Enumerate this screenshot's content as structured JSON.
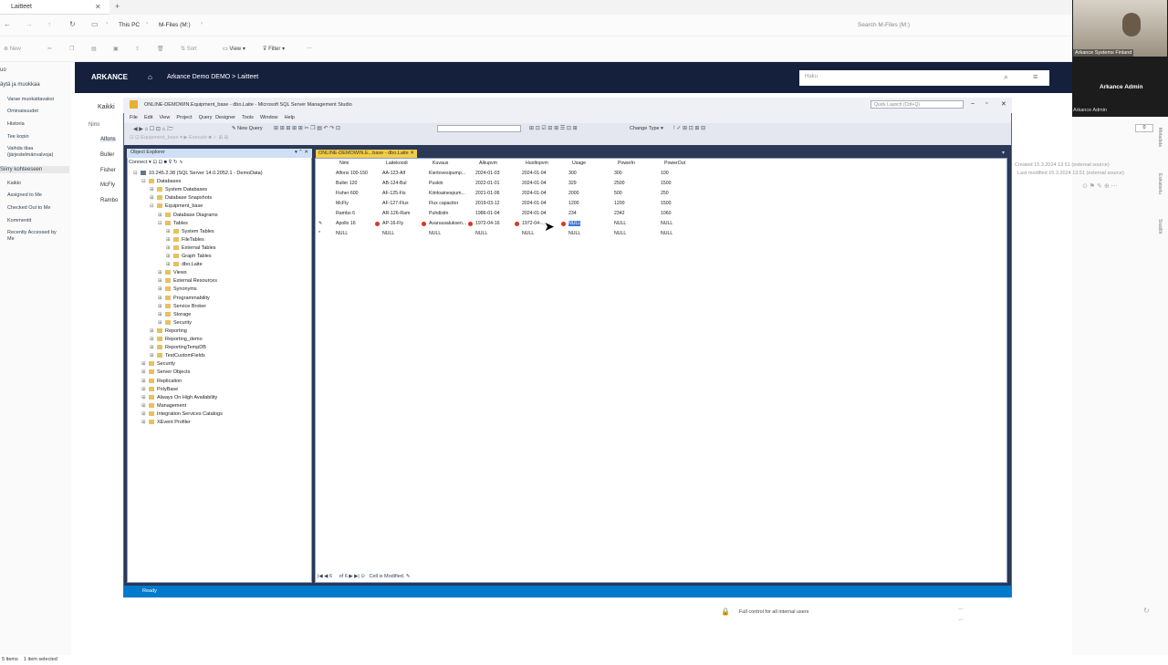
{
  "explorer": {
    "tab_title": "Laitteet",
    "breadcrumb": [
      "This PC",
      "M-Files (M:)"
    ],
    "search_placeholder": "Search M-Files (M:)",
    "cmd": {
      "new": "New",
      "sort": "Sort",
      "view": "View",
      "filter": "Filter",
      "more": "···"
    },
    "left_items": [
      "uo",
      "äytä ja muokkaa",
      "Varae muokattavaksi",
      "Ominaisuudet",
      "Historia",
      "Tee kopio",
      "Vaihda tilaa (järjestelmänvalvoja)",
      "Siirry kohteeseen",
      "Kaikki",
      "Assigned to Me",
      "Checked Out to Me",
      "Kommentit",
      "Recently Accessed by Me"
    ],
    "status": {
      "items": "5 items",
      "selected": "1 item selected"
    }
  },
  "mfiles": {
    "logo": "ARKANCE",
    "crumb": "Arkance Demo DEMO > Laitteet",
    "search_placeholder": "Haku",
    "view_label": "Kaikki",
    "col_name": "Nimi",
    "list": [
      "Alfons",
      "Buller",
      "Fisher",
      "McFly",
      "Rambo"
    ],
    "count": "0",
    "created": "Created 15.3.2024 13.51 (external source)",
    "modified": "Last modified 15.3.2024 13.51 (external source)",
    "permission": "Full control for all internal users",
    "side_tabs": [
      "Metadata",
      "Esikatselu",
      "Sisällöt"
    ]
  },
  "meeting": {
    "org": "Arkance Systems Finland",
    "user": "Arkance Admin",
    "user_small": "Arkance Admin"
  },
  "ssms": {
    "title": "ONLINE-DEMOWIN.Equipment_base - dbo.Laite - Microsoft SQL Server Management Studio",
    "quick_launch": "Quick Launch (Ctrl+Q)",
    "menu": [
      "File",
      "Edit",
      "View",
      "Project",
      "Query Designer",
      "Tools",
      "Window",
      "Help"
    ],
    "new_query": "New Query",
    "change_type": "Change Type",
    "execute": "Execute",
    "db_select": "Equipment_base",
    "oe_title": "Object Explorer",
    "connect": "Connect",
    "tab_label": "ONLINE-DEMOWIN.E...base - dbo.Laite",
    "status": "Ready",
    "nav": {
      "page": "6",
      "of": "of 6",
      "cell_msg": "Cell is Modified."
    }
  },
  "tree": [
    {
      "label": "10.245.2.38 (SQL Server 14.0.2052.1 - DemoData)",
      "lvl": 0,
      "pm": "⊟"
    },
    {
      "label": "Databases",
      "lvl": 1,
      "pm": "⊟"
    },
    {
      "label": "System Databases",
      "lvl": 2,
      "pm": "⊞"
    },
    {
      "label": "Database Snapshots",
      "lvl": 2,
      "pm": "⊞"
    },
    {
      "label": "Equipment_base",
      "lvl": 2,
      "pm": "⊟"
    },
    {
      "label": "Database Diagrams",
      "lvl": 3,
      "pm": "⊞"
    },
    {
      "label": "Tables",
      "lvl": 3,
      "pm": "⊟"
    },
    {
      "label": "System Tables",
      "lvl": 4,
      "pm": "⊞"
    },
    {
      "label": "FileTables",
      "lvl": 4,
      "pm": "⊞"
    },
    {
      "label": "External Tables",
      "lvl": 4,
      "pm": "⊞"
    },
    {
      "label": "Graph Tables",
      "lvl": 4,
      "pm": "⊞"
    },
    {
      "label": "dbo.Laite",
      "lvl": 4,
      "pm": "⊞"
    },
    {
      "label": "Views",
      "lvl": 3,
      "pm": "⊞"
    },
    {
      "label": "External Resources",
      "lvl": 3,
      "pm": "⊞"
    },
    {
      "label": "Synonyms",
      "lvl": 3,
      "pm": "⊞"
    },
    {
      "label": "Programmability",
      "lvl": 3,
      "pm": "⊞"
    },
    {
      "label": "Service Broker",
      "lvl": 3,
      "pm": "⊞"
    },
    {
      "label": "Storage",
      "lvl": 3,
      "pm": "⊞"
    },
    {
      "label": "Security",
      "lvl": 3,
      "pm": "⊞"
    },
    {
      "label": "Reporting",
      "lvl": 2,
      "pm": "⊞"
    },
    {
      "label": "Reporting_demo",
      "lvl": 2,
      "pm": "⊞"
    },
    {
      "label": "ReportingTempDB",
      "lvl": 2,
      "pm": "⊞"
    },
    {
      "label": "TestCustomFields",
      "lvl": 2,
      "pm": "⊞"
    },
    {
      "label": "Security",
      "lvl": 1,
      "pm": "⊞"
    },
    {
      "label": "Server Objects",
      "lvl": 1,
      "pm": "⊞"
    },
    {
      "label": "Replication",
      "lvl": 1,
      "pm": "⊞"
    },
    {
      "label": "PolyBase",
      "lvl": 1,
      "pm": "⊞"
    },
    {
      "label": "Always On High Availability",
      "lvl": 1,
      "pm": "⊞"
    },
    {
      "label": "Management",
      "lvl": 1,
      "pm": "⊞"
    },
    {
      "label": "Integration Services Catalogs",
      "lvl": 1,
      "pm": "⊞"
    },
    {
      "label": "XEvent Profiler",
      "lvl": 1,
      "pm": "⊞"
    }
  ],
  "table": {
    "columns": [
      "Nimi",
      "Laitekoodi",
      "Kuvaus",
      "Alkupvm",
      "Huoltopvm",
      "Usage",
      "PowerIn",
      "PowerOut"
    ],
    "rows": [
      [
        "Alfons 100-150",
        "AA-123-Alf",
        "Kiertovesipump...",
        "2024-01-03",
        "2024-01-04",
        "300",
        "300",
        "100"
      ],
      [
        "Buller 120",
        "AB-124-Bul",
        "Puskin",
        "2022-01-01",
        "2024-01-04",
        "329",
        "2500",
        "1500"
      ],
      [
        "Fisher 600",
        "AF-125-Fis",
        "Kiintoainespum...",
        "2021-01-06",
        "2024-01-04",
        "2000",
        "500",
        "250"
      ],
      [
        "McFly",
        "AF-127-Flux",
        "Flux capacitor",
        "2019-03-12",
        "2024-01-04",
        "1200",
        "1200",
        "1500"
      ],
      [
        "Rambo 6",
        "AR-126-Ram",
        "Puhdistin",
        "1986-01-04",
        "2024-01-04",
        "234",
        "2342",
        "1060"
      ],
      [
        "Apollo 16",
        "AP-16-Fly",
        "Avaruusaluksen...",
        "1972-04-16",
        "1972-04-...",
        "NULL",
        "NULL",
        "NULL"
      ],
      [
        "NULL",
        "NULL",
        "NULL",
        "NULL",
        "NULL",
        "NULL",
        "NULL",
        "NULL"
      ]
    ],
    "row_markers": [
      "",
      "",
      "",
      "",
      "",
      "✎",
      "*"
    ],
    "selected_cell_value": "NULL"
  }
}
